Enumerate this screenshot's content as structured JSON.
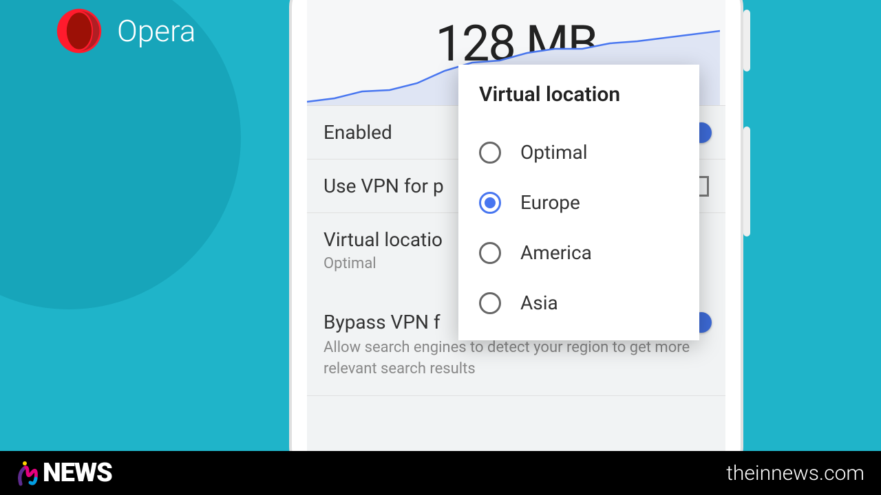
{
  "brand": {
    "name": "Opera",
    "logo_colors": {
      "dark_red": "#b01f24",
      "red": "#ff1b2d"
    }
  },
  "usage": {
    "value": "128 MB"
  },
  "chart_data": {
    "type": "area",
    "title": "",
    "xlabel": "",
    "ylabel": "",
    "x": [
      0,
      1,
      2,
      3,
      4,
      5,
      6,
      7,
      8,
      9,
      10,
      11,
      12,
      13,
      14
    ],
    "values": [
      8,
      12,
      20,
      22,
      30,
      48,
      58,
      62,
      72,
      78,
      78,
      85,
      88,
      92,
      100
    ],
    "ylim": [
      0,
      128
    ],
    "stroke": "#4876f0",
    "fill": "#dfe5f4"
  },
  "settings": {
    "enabled": {
      "label": "Enabled",
      "value": true
    },
    "private_tabs": {
      "label": "Use VPN for p",
      "checked": false
    },
    "virtual_location": {
      "label": "Virtual locatio",
      "sublabel": "Optimal"
    },
    "bypass": {
      "label": "Bypass VPN f",
      "description": "Allow search engines to detect your region to get more relevant search results",
      "value": true
    }
  },
  "dialog": {
    "title": "Virtual location",
    "options": [
      {
        "label": "Optimal",
        "selected": false
      },
      {
        "label": "Europe",
        "selected": true
      },
      {
        "label": "America",
        "selected": false
      },
      {
        "label": "Asia",
        "selected": false
      }
    ]
  },
  "footer": {
    "brand_prefix": "N",
    "brand_text": "NEWS",
    "url": "theinnews.com"
  }
}
